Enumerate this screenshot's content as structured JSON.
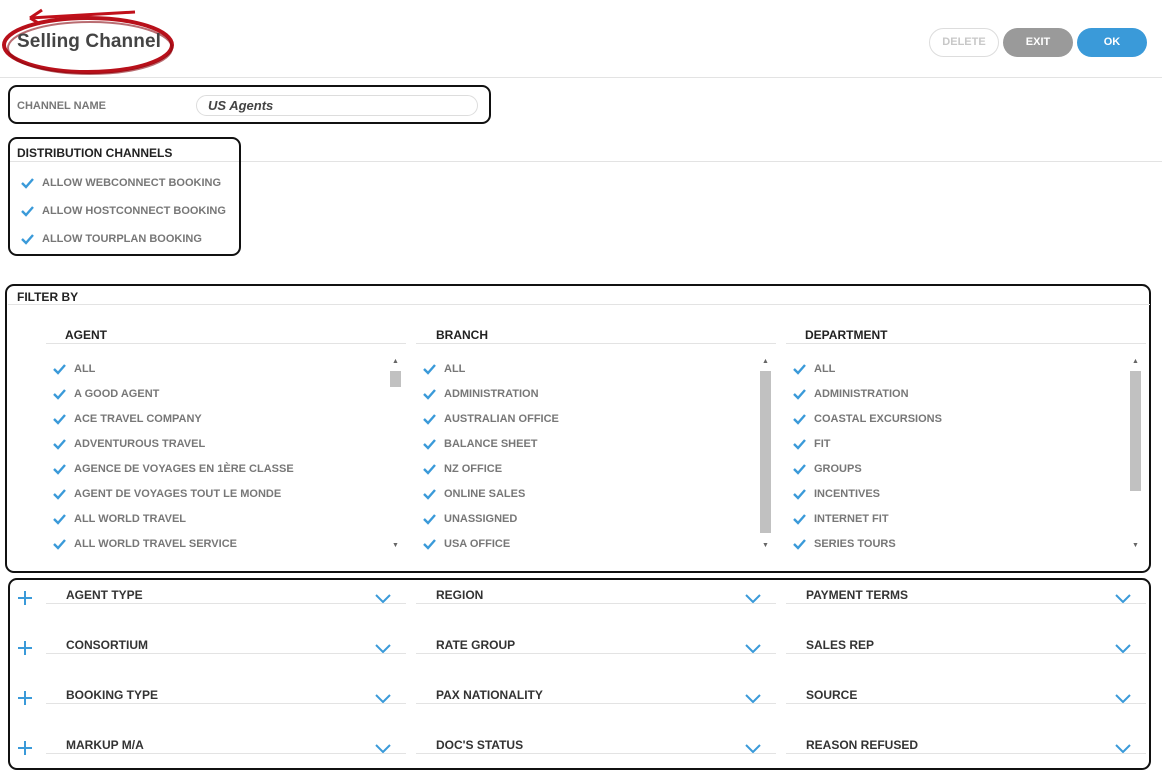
{
  "header": {
    "title": "Selling Channel",
    "buttons": {
      "delete": "DELETE",
      "exit": "EXIT",
      "ok": "OK"
    }
  },
  "channel_name": {
    "label": "CHANNEL NAME",
    "value": "US Agents"
  },
  "distribution": {
    "title": "DISTRIBUTION CHANNELS",
    "options": [
      {
        "label": "ALLOW WEBCONNECT BOOKING",
        "checked": true
      },
      {
        "label": "ALLOW HOSTCONNECT BOOKING",
        "checked": true
      },
      {
        "label": "ALLOW TOURPLAN BOOKING",
        "checked": true
      }
    ]
  },
  "filter": {
    "title": "FILTER BY",
    "columns": [
      {
        "title": "AGENT",
        "items": [
          "ALL",
          "A GOOD AGENT",
          "ACE TRAVEL COMPANY",
          "ADVENTUROUS TRAVEL",
          "AGENCE DE VOYAGES EN 1ÈRE CLASSE",
          "AGENT DE VOYAGES TOUT LE MONDE",
          "ALL WORLD TRAVEL",
          "ALL WORLD TRAVEL SERVICE"
        ]
      },
      {
        "title": "BRANCH",
        "items": [
          "ALL",
          "ADMINISTRATION",
          "AUSTRALIAN OFFICE",
          "BALANCE SHEET",
          "NZ OFFICE",
          "ONLINE SALES",
          "UNASSIGNED",
          "USA OFFICE"
        ]
      },
      {
        "title": "DEPARTMENT",
        "items": [
          "ALL",
          "ADMINISTRATION",
          "COASTAL EXCURSIONS",
          "FIT",
          "GROUPS",
          "INCENTIVES",
          "INTERNET FIT",
          "SERIES TOURS"
        ]
      }
    ]
  },
  "more_filters": {
    "rows": [
      [
        "AGENT TYPE",
        "REGION",
        "PAYMENT TERMS"
      ],
      [
        "CONSORTIUM",
        "RATE GROUP",
        "SALES REP"
      ],
      [
        "BOOKING TYPE",
        "PAX NATIONALITY",
        "SOURCE"
      ],
      [
        "MARKUP M/A",
        "DOC'S STATUS",
        "REASON REFUSED"
      ]
    ]
  },
  "colors": {
    "accent": "#3a9ad9",
    "annotation": "#c0101a",
    "border": "#111111"
  },
  "icons": {
    "check": "check-icon",
    "plus": "plus-icon",
    "chevron": "chevron-down-icon"
  }
}
